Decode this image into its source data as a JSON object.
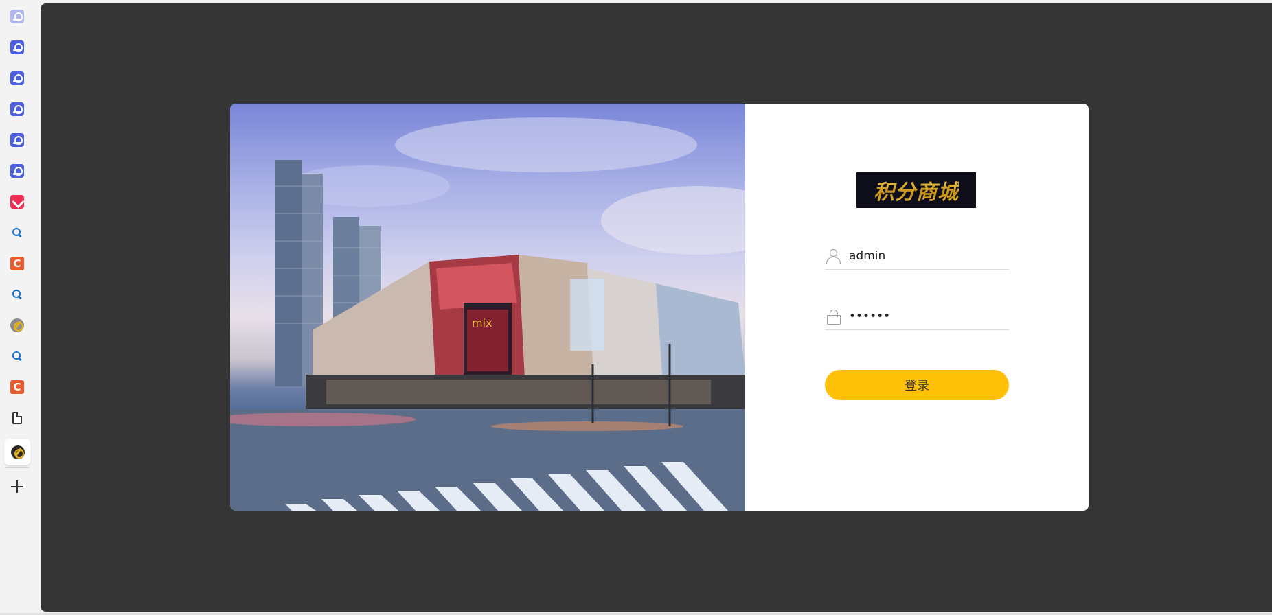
{
  "sidebar": {
    "items": [
      {
        "name": "qq-app-icon"
      },
      {
        "name": "qq-app-icon"
      },
      {
        "name": "qq-app-icon"
      },
      {
        "name": "qq-app-icon"
      },
      {
        "name": "qq-app-icon"
      },
      {
        "name": "qq-app-icon"
      },
      {
        "name": "heart-app-icon"
      },
      {
        "name": "search-app-icon"
      },
      {
        "name": "c-app-icon"
      },
      {
        "name": "search-app-icon"
      },
      {
        "name": "bolt-app-icon"
      },
      {
        "name": "search-app-icon"
      },
      {
        "name": "c-app-icon"
      },
      {
        "name": "document-icon"
      },
      {
        "name": "bolt-app-icon"
      },
      {
        "name": "plus-icon"
      }
    ],
    "c_letter": "C"
  },
  "login": {
    "logo_text": "积分商城",
    "username_value": "admin",
    "password_value": "••••••",
    "submit_label": "登录"
  },
  "colors": {
    "page_background": "#353535",
    "button": "#ffc107",
    "logo_gold": "#e0a823"
  }
}
